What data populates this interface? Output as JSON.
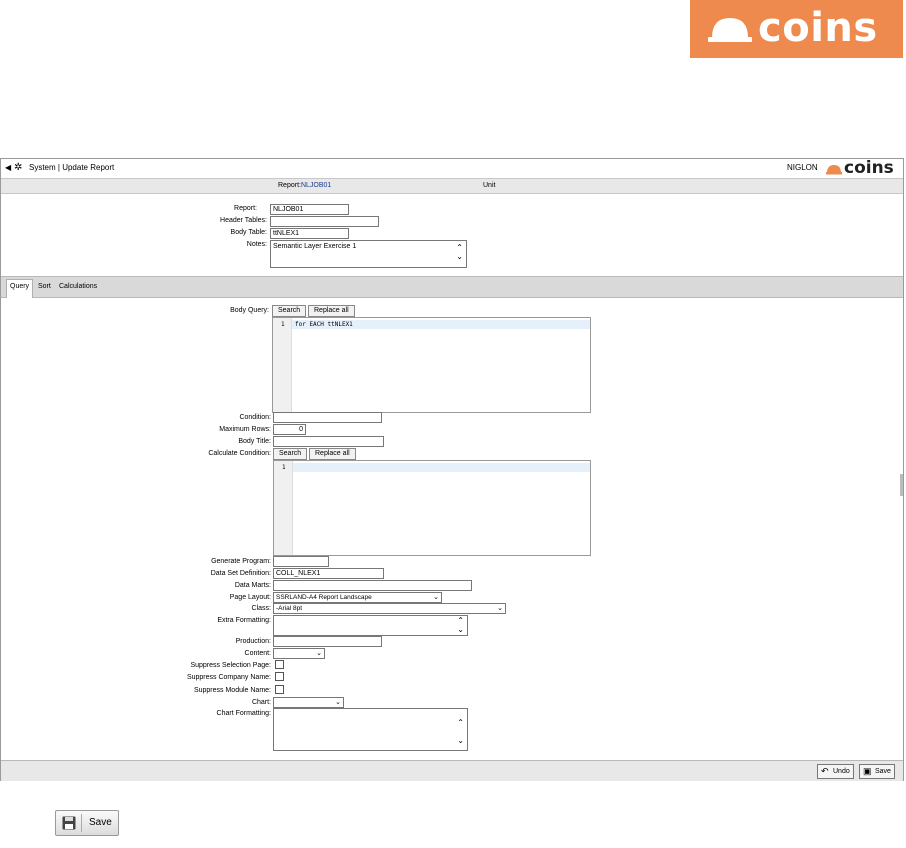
{
  "brand": {
    "logo_text": "coins",
    "accent": "#ef8a4f"
  },
  "titlebar": {
    "title": "System | Update Report",
    "user": "NIGLON",
    "logo_text": "coins"
  },
  "infobar": {
    "report_label": "Report:",
    "report_value": "NLJOB01",
    "unit_label": "Unit"
  },
  "header_form": {
    "report_label": "Report:",
    "report_value": "NLJOB01",
    "header_tables_label": "Header Tables:",
    "header_tables_value": "",
    "body_table_label": "Body Table:",
    "body_table_value": "ttNLEX1",
    "notes_label": "Notes:",
    "notes_value": "Semantic Layer Exercise 1"
  },
  "tabs": [
    {
      "label": "Query",
      "active": true
    },
    {
      "label": "Sort",
      "active": false
    },
    {
      "label": "Calculations",
      "active": false
    }
  ],
  "query": {
    "body_query_label": "Body Query:",
    "search_label": "Search",
    "replace_all_label": "Replace all",
    "body_query_lines": [
      {
        "num": "1",
        "code": "for EACH ttNLEX1"
      }
    ],
    "condition_label": "Condition:",
    "condition_value": "",
    "max_rows_label": "Maximum Rows:",
    "max_rows_value": "0",
    "body_title_label": "Body Title:",
    "body_title_value": "",
    "calc_condition_label": "Calculate Condition:",
    "calc_lines": [
      {
        "num": "1",
        "code": ""
      }
    ],
    "generate_program_label": "Generate Program:",
    "generate_program_value": "",
    "data_set_def_label": "Data Set Definition:",
    "data_set_def_value": "COLL_NLEX1",
    "data_marts_label": "Data Marts:",
    "data_marts_value": "",
    "page_layout_label": "Page Layout:",
    "page_layout_value": "SSRLAND-A4 Report Landscape",
    "class_label": "Class:",
    "class_value": "-Arial 8pt",
    "extra_formatting_label": "Extra Formatting:",
    "extra_formatting_value": "",
    "production_label": "Production:",
    "production_value": "",
    "content_label": "Content:",
    "content_value": "",
    "suppress_selection_label": "Suppress Selection Page:",
    "suppress_selection": false,
    "suppress_company_label": "Suppress Company Name:",
    "suppress_company": false,
    "suppress_module_label": "Suppress Module Name:",
    "suppress_module": false,
    "chart_label": "Chart:",
    "chart_value": "",
    "chart_formatting_label": "Chart Formatting:",
    "chart_formatting_value": ""
  },
  "footer": {
    "undo_label": "Undo",
    "save_label": "Save"
  },
  "callout": {
    "save_label": "Save"
  }
}
